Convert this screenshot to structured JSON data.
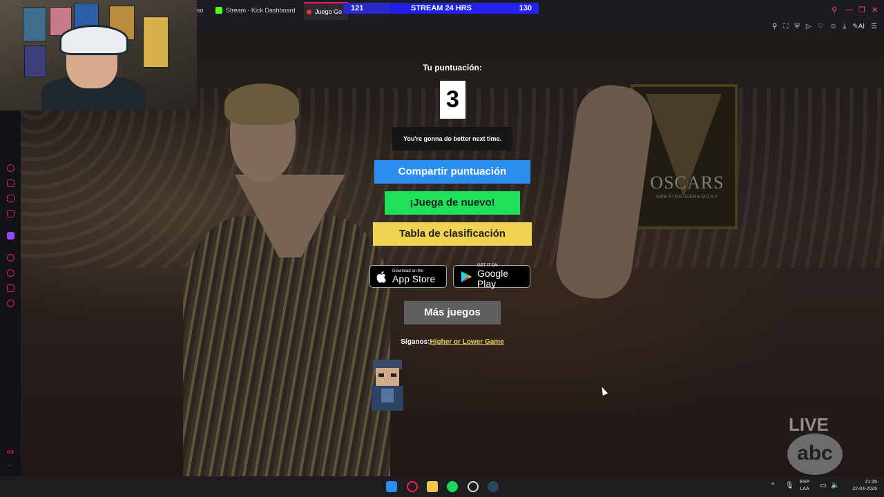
{
  "browser": {
    "tabs": [
      {
        "label": "so",
        "icon": "tab-icon"
      },
      {
        "label": "Stream - Kick Dashboard",
        "icon": "kick-icon"
      },
      {
        "label": "Juego Go",
        "icon": "game-icon",
        "active": true
      }
    ],
    "toolbar_icons": [
      "pin-icon",
      "screenshot-icon",
      "shield-icon",
      "play-icon",
      "heart-icon",
      "profile-icon",
      "download-icon",
      "ai-icon",
      "menu-icon"
    ],
    "ai_label": "AI"
  },
  "stream_overlay": {
    "left_score": "121",
    "title": "STREAM 24 HRS",
    "right_score": "130"
  },
  "game": {
    "score_label": "Tu puntuación:",
    "score_value": "3",
    "message": "You're gonna do better next time.",
    "share_button": "Compartir puntuación",
    "play_again_button": "¡Juega de nuevo!",
    "leaderboard_button": "Tabla de clasificación",
    "app_store": {
      "small": "Download on the",
      "big": "App Store"
    },
    "google_play": {
      "small": "GET IT ON",
      "big": "Google Play"
    },
    "more_games_button": "Más juegos",
    "follow_label": "Síganos:",
    "follow_link": "Higher or Lower Game"
  },
  "background": {
    "sign_text": "OSCARS",
    "sign_sub": "OPENING CEREMONY",
    "live_label": "LIVE",
    "network_logo": "abc"
  },
  "sidebar": {
    "bottom_label": "GX"
  },
  "taskbar": {
    "lang": "ESP",
    "layout": "LAA",
    "time": "21:35",
    "date": "22-04-2026"
  },
  "colors": {
    "accent": "#ff1a5e",
    "share": "#2b8ff2",
    "again": "#1fe05a",
    "board": "#f0d353",
    "more": "#5f5f5f",
    "link": "#e8cf62"
  }
}
